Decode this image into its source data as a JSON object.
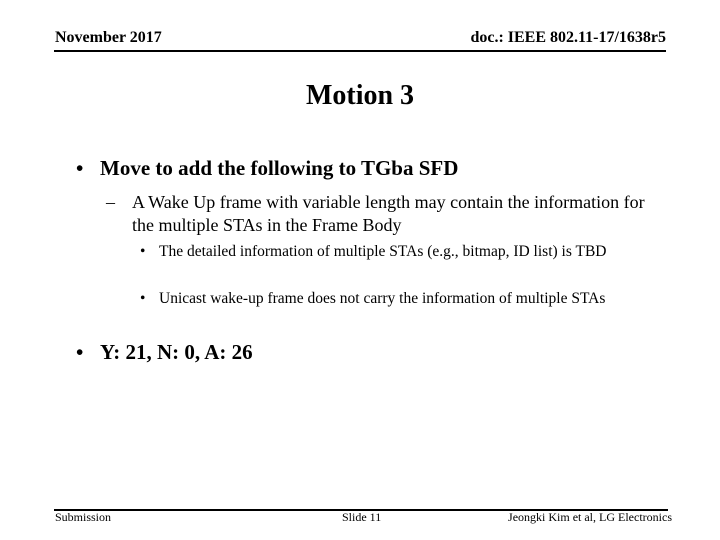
{
  "header": {
    "date": "November 2017",
    "doc_id": "doc.: IEEE 802.11-17/1638r5"
  },
  "title": "Motion 3",
  "bullets": [
    {
      "symbol": "•",
      "text": "Move to add the following to TGba SFD",
      "sub": [
        {
          "symbol": "–",
          "text": "A Wake Up frame with variable length may contain the information for the multiple STAs in the Frame Body",
          "sub": [
            {
              "symbol": "•",
              "text": "The detailed information of multiple STAs (e.g., bitmap, ID list) is TBD"
            },
            {
              "symbol": "•",
              "text": "Unicast wake-up frame does not carry the information of multiple STAs"
            }
          ]
        }
      ]
    },
    {
      "symbol": "•",
      "text": "Y: 21, N: 0, A: 26"
    }
  ],
  "footer": {
    "left": "Submission",
    "center": "Slide 11",
    "right": "Jeongki Kim et al, LG Electronics"
  }
}
